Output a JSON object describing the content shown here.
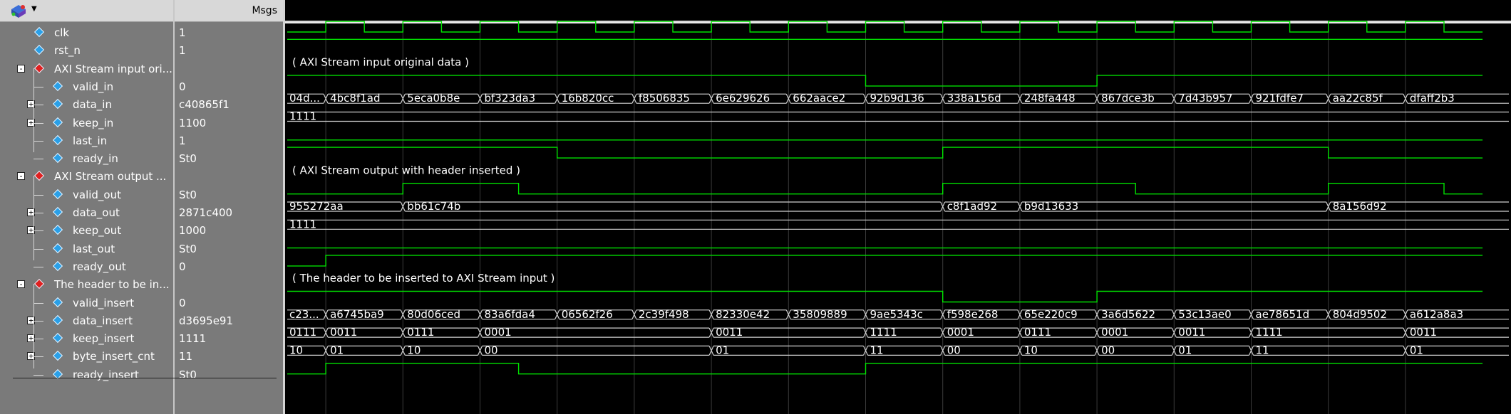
{
  "header": {
    "msgs_label": "Msgs"
  },
  "colors": {
    "wave": "#00e000",
    "text": "#ffffff",
    "grid": "#3a3a3a",
    "panel": "#7a7a7a"
  },
  "signals": [
    {
      "name": "clk",
      "value": "1",
      "icon": "blue",
      "indent": 1,
      "expand": null
    },
    {
      "name": "rst_n",
      "value": "1",
      "icon": "blue",
      "indent": 1,
      "expand": null
    },
    {
      "name": "AXI Stream input ori...",
      "value": "",
      "icon": "red",
      "indent": 0,
      "expand": "-"
    },
    {
      "name": "valid_in",
      "value": "0",
      "icon": "blue",
      "indent": 2,
      "expand": null
    },
    {
      "name": "data_in",
      "value": "c40865f1",
      "icon": "blue",
      "indent": 2,
      "expand": "+"
    },
    {
      "name": "keep_in",
      "value": "1100",
      "icon": "blue",
      "indent": 2,
      "expand": "+"
    },
    {
      "name": "last_in",
      "value": "1",
      "icon": "blue",
      "indent": 2,
      "expand": null
    },
    {
      "name": "ready_in",
      "value": "St0",
      "icon": "blue",
      "indent": 2,
      "expand": null
    },
    {
      "name": "AXI Stream output ...",
      "value": "",
      "icon": "red",
      "indent": 0,
      "expand": "-"
    },
    {
      "name": "valid_out",
      "value": "St0",
      "icon": "blue",
      "indent": 2,
      "expand": null
    },
    {
      "name": "data_out",
      "value": "2871c400",
      "icon": "blue",
      "indent": 2,
      "expand": "+"
    },
    {
      "name": "keep_out",
      "value": "1000",
      "icon": "blue",
      "indent": 2,
      "expand": "+"
    },
    {
      "name": "last_out",
      "value": "St0",
      "icon": "blue",
      "indent": 2,
      "expand": null
    },
    {
      "name": "ready_out",
      "value": "0",
      "icon": "blue",
      "indent": 2,
      "expand": null
    },
    {
      "name": "The header to be in...",
      "value": "",
      "icon": "red",
      "indent": 0,
      "expand": "-"
    },
    {
      "name": "valid_insert",
      "value": "0",
      "icon": "blue",
      "indent": 2,
      "expand": null
    },
    {
      "name": "data_insert",
      "value": "d3695e91",
      "icon": "blue",
      "indent": 2,
      "expand": "+"
    },
    {
      "name": "keep_insert",
      "value": "1111",
      "icon": "blue",
      "indent": 2,
      "expand": "+"
    },
    {
      "name": "byte_insert_cnt",
      "value": "11",
      "icon": "blue",
      "indent": 2,
      "expand": "+"
    },
    {
      "name": "ready_insert",
      "value": "St0",
      "icon": "blue",
      "indent": 2,
      "expand": null
    }
  ],
  "group_titles": [
    {
      "row": 2,
      "text": "( AXI Stream input original data )"
    },
    {
      "row": 8,
      "text": "( AXI Stream output with header inserted )"
    },
    {
      "row": 14,
      "text": "( The header to be inserted to AXI Stream input )"
    }
  ],
  "bus_waves": [
    {
      "row": 4,
      "segments": [
        {
          "t": 0,
          "label": "04d..."
        },
        {
          "t": 1,
          "label": "4bc8f1ad"
        },
        {
          "t": 3,
          "label": "5eca0b8e"
        },
        {
          "t": 5,
          "label": "bf323da3"
        },
        {
          "t": 7,
          "label": "16b820cc"
        },
        {
          "t": 9,
          "label": "f8506835"
        },
        {
          "t": 11,
          "label": "6e629626"
        },
        {
          "t": 13,
          "label": "662aace2"
        },
        {
          "t": 15,
          "label": "92b9d136"
        },
        {
          "t": 17,
          "label": "338a156d"
        },
        {
          "t": 19,
          "label": "248fa448"
        },
        {
          "t": 21,
          "label": "867dce3b"
        },
        {
          "t": 23,
          "label": "7d43b957"
        },
        {
          "t": 25,
          "label": "921fdfe7"
        },
        {
          "t": 27,
          "label": "aa22c85f"
        },
        {
          "t": 29,
          "label": "dfaff2b3"
        }
      ]
    },
    {
      "row": 5,
      "segments": [
        {
          "t": 0,
          "label": "1111"
        }
      ]
    },
    {
      "row": 10,
      "segments": [
        {
          "t": 0,
          "label": "955272aa"
        },
        {
          "t": 3,
          "label": "bb61c74b"
        },
        {
          "t": 17,
          "label": "c8f1ad92"
        },
        {
          "t": 19,
          "label": "b9d13633"
        },
        {
          "t": 27,
          "label": "8a156d92"
        }
      ]
    },
    {
      "row": 11,
      "segments": [
        {
          "t": 0,
          "label": "1111"
        }
      ]
    },
    {
      "row": 16,
      "segments": [
        {
          "t": 0,
          "label": "c23..."
        },
        {
          "t": 1,
          "label": "a6745ba9"
        },
        {
          "t": 3,
          "label": "80d06ced"
        },
        {
          "t": 5,
          "label": "83a6fda4"
        },
        {
          "t": 7,
          "label": "06562f26"
        },
        {
          "t": 9,
          "label": "2c39f498"
        },
        {
          "t": 11,
          "label": "82330e42"
        },
        {
          "t": 13,
          "label": "35809889"
        },
        {
          "t": 15,
          "label": "9ae5343c"
        },
        {
          "t": 17,
          "label": "f598e268"
        },
        {
          "t": 19,
          "label": "65e220c9"
        },
        {
          "t": 21,
          "label": "3a6d5622"
        },
        {
          "t": 23,
          "label": "53c13ae0"
        },
        {
          "t": 25,
          "label": "ae78651d"
        },
        {
          "t": 27,
          "label": "804d9502"
        },
        {
          "t": 29,
          "label": "a612a8a3"
        }
      ]
    },
    {
      "row": 17,
      "segments": [
        {
          "t": 0,
          "label": "0111"
        },
        {
          "t": 1,
          "label": "0011"
        },
        {
          "t": 3,
          "label": "0111"
        },
        {
          "t": 5,
          "label": "0001"
        },
        {
          "t": 11,
          "label": "0011"
        },
        {
          "t": 15,
          "label": "1111"
        },
        {
          "t": 17,
          "label": "0001"
        },
        {
          "t": 19,
          "label": "0111"
        },
        {
          "t": 21,
          "label": "0001"
        },
        {
          "t": 23,
          "label": "0011"
        },
        {
          "t": 25,
          "label": "1111"
        },
        {
          "t": 29,
          "label": "0011"
        }
      ]
    },
    {
      "row": 18,
      "segments": [
        {
          "t": 0,
          "label": "10"
        },
        {
          "t": 1,
          "label": "01"
        },
        {
          "t": 3,
          "label": "10"
        },
        {
          "t": 5,
          "label": "00"
        },
        {
          "t": 11,
          "label": "01"
        },
        {
          "t": 15,
          "label": "11"
        },
        {
          "t": 17,
          "label": "00"
        },
        {
          "t": 19,
          "label": "10"
        },
        {
          "t": 21,
          "label": "00"
        },
        {
          "t": 23,
          "label": "01"
        },
        {
          "t": 25,
          "label": "11"
        },
        {
          "t": 29,
          "label": "01"
        }
      ]
    }
  ],
  "bit_waves": [
    {
      "row": 0,
      "levels": [
        0,
        1,
        0,
        1,
        0,
        1,
        0,
        1,
        0,
        1,
        0,
        1,
        0,
        1,
        0,
        1,
        0,
        1,
        0,
        1,
        0,
        1,
        0,
        1,
        0,
        1,
        0,
        1,
        0,
        1,
        0
      ]
    },
    {
      "row": 1,
      "levels": [
        1,
        1,
        1,
        1,
        1,
        1,
        1,
        1,
        1,
        1,
        1,
        1,
        1,
        1,
        1,
        1,
        1,
        1,
        1,
        1,
        1,
        1,
        1,
        1,
        1,
        1,
        1,
        1,
        1,
        1,
        1
      ]
    },
    {
      "row": 3,
      "levels": [
        1,
        1,
        1,
        1,
        1,
        1,
        1,
        1,
        1,
        1,
        1,
        1,
        1,
        1,
        1,
        0,
        0,
        0,
        0,
        0,
        0,
        1,
        1,
        1,
        1,
        1,
        1,
        1,
        1,
        1,
        1
      ]
    },
    {
      "row": 6,
      "levels": [
        0,
        0,
        0,
        0,
        0,
        0,
        0,
        0,
        0,
        0,
        0,
        0,
        0,
        0,
        0,
        0,
        0,
        0,
        0,
        0,
        0,
        0,
        0,
        0,
        0,
        0,
        0,
        0,
        0,
        0,
        0
      ]
    },
    {
      "row": 7,
      "levels": [
        1,
        1,
        1,
        1,
        1,
        1,
        1,
        0,
        0,
        0,
        0,
        0,
        0,
        0,
        0,
        0,
        0,
        1,
        1,
        1,
        1,
        1,
        1,
        1,
        1,
        1,
        1,
        0,
        0,
        0,
        0
      ]
    },
    {
      "row": 9,
      "levels": [
        0,
        0,
        0,
        1,
        1,
        1,
        0,
        0,
        0,
        0,
        0,
        0,
        0,
        0,
        0,
        0,
        0,
        1,
        1,
        1,
        1,
        1,
        0,
        0,
        0,
        0,
        0,
        1,
        1,
        1,
        0
      ]
    },
    {
      "row": 12,
      "levels": [
        0,
        0,
        0,
        0,
        0,
        0,
        0,
        0,
        0,
        0,
        0,
        0,
        0,
        0,
        0,
        0,
        0,
        0,
        0,
        0,
        0,
        0,
        0,
        0,
        0,
        0,
        0,
        0,
        0,
        0,
        0
      ]
    },
    {
      "row": 13,
      "levels": [
        0,
        1,
        1,
        1,
        1,
        1,
        1,
        1,
        1,
        1,
        1,
        1,
        1,
        1,
        1,
        1,
        1,
        1,
        1,
        1,
        1,
        1,
        1,
        1,
        1,
        1,
        1,
        1,
        1,
        1,
        1
      ]
    },
    {
      "row": 15,
      "levels": [
        1,
        1,
        1,
        1,
        1,
        1,
        1,
        1,
        1,
        1,
        1,
        1,
        1,
        1,
        1,
        1,
        1,
        0,
        0,
        0,
        0,
        1,
        1,
        1,
        1,
        1,
        1,
        1,
        1,
        1,
        1
      ]
    },
    {
      "row": 19,
      "levels": [
        0,
        1,
        1,
        1,
        1,
        1,
        0,
        0,
        0,
        0,
        0,
        0,
        0,
        0,
        0,
        1,
        1,
        1,
        1,
        1,
        1,
        1,
        1,
        1,
        1,
        1,
        1,
        1,
        1,
        1,
        1
      ]
    }
  ]
}
